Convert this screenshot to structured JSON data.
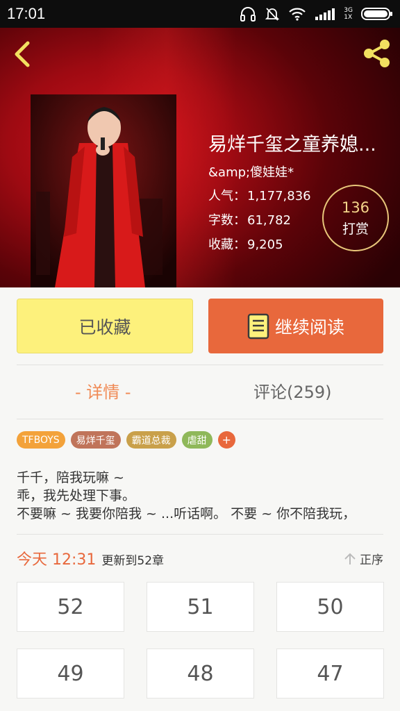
{
  "status_bar": {
    "time": "17:01",
    "network": "3G\n1X"
  },
  "book": {
    "title": "易烊千玺之童养媳...",
    "author": "&amp;傻娃娃*",
    "stats": [
      {
        "label": "人气：",
        "value": "1,177,836"
      },
      {
        "label": "字数：",
        "value": "61,782"
      },
      {
        "label": "收藏：",
        "value": "9,205"
      }
    ],
    "reward": {
      "count": "136",
      "label": "打赏"
    }
  },
  "actions": {
    "favorite_label": "已收藏",
    "read_label": "继续阅读"
  },
  "tabs": {
    "detail": "- 详情 -",
    "comments": "评论(259)"
  },
  "tags": [
    {
      "label": "TFBOYS",
      "color": "#f3a23a"
    },
    {
      "label": "易烊千玺",
      "color": "#c0745a"
    },
    {
      "label": "霸道总裁",
      "color": "#c9a04a"
    },
    {
      "label": "虐甜",
      "color": "#8fb85a"
    }
  ],
  "tag_plus": "+",
  "description": [
    "千千，陪我玩嘛 ~",
    "乖，我先处理下事。",
    "不要嘛 ~ 我要你陪我 ~ ...听话啊。 不要 ~ 你不陪我玩，"
  ],
  "update": {
    "today": "今天 12:31",
    "info": "更新到52章"
  },
  "order_label": "正序",
  "chapters": [
    "52",
    "51",
    "50",
    "49",
    "48",
    "47"
  ],
  "colors": {
    "accent": "#e8683c",
    "favorite_bg": "#fdf17c",
    "tab_active": "#f08a55",
    "reward_ring": "#e8c67a"
  }
}
